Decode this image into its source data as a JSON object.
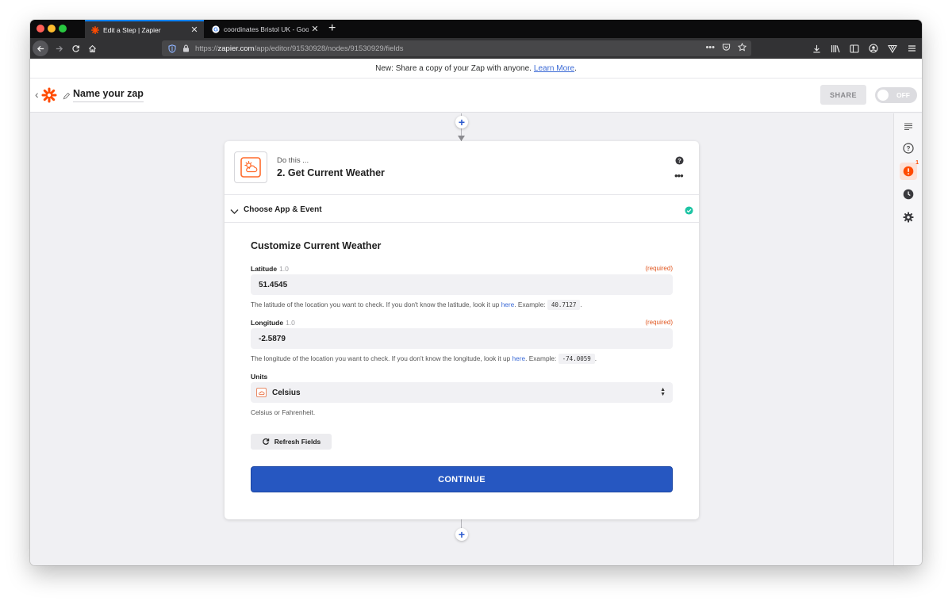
{
  "browser": {
    "tabs": [
      {
        "label": "Edit a Step | Zapier",
        "icon": "zapier-favicon",
        "active": true
      },
      {
        "label": "coordinates Bristol UK - Google",
        "icon": "google-favicon",
        "active": false
      }
    ],
    "new_tab": "+",
    "url": {
      "prefix": "https://",
      "host": "zapier.com",
      "path": "/app/editor/91530928/nodes/91530929/fields"
    },
    "url_actions": [
      "more-icon",
      "pocket-icon",
      "bookmark-star-icon"
    ],
    "toolbar_icons": [
      "download-icon",
      "library-icon",
      "sidebar-icon",
      "account-icon",
      "vpn-icon",
      "menu-icon"
    ]
  },
  "banner": {
    "text": "New: Share a copy of your Zap with anyone.",
    "link": "Learn More",
    "period": "."
  },
  "header": {
    "zap_name": "Name your zap",
    "share": "SHARE",
    "toggle": "OFF"
  },
  "sidebar": {
    "icons": [
      "notes-icon",
      "help-circle-icon",
      "alert-icon",
      "history-icon",
      "settings-icon"
    ],
    "alert_count": "1"
  },
  "step": {
    "prefix": "Do this ...",
    "title": "2. Get Current Weather",
    "accordion_label": "Choose App & Event",
    "section_title": "Customize Current Weather",
    "latitude": {
      "label": "Latitude",
      "version": "1.0",
      "required": "(required)",
      "value": "51.4545",
      "help_before": "The latitude of the location you want to check. If you don't know the latitude, look it up",
      "help_link": "here",
      "help_example": ". Example:",
      "example_value": "40.7127",
      "help_after": "."
    },
    "longitude": {
      "label": "Longitude",
      "version": "1.0",
      "required": "(required)",
      "value": "-2.5879",
      "help_before": "The longitude of the location you want to check. If you don't know the longitude, look it up",
      "help_link": "here",
      "help_example": ". Example:",
      "example_value": "-74.0059",
      "help_after": "."
    },
    "units": {
      "label": "Units",
      "value": "Celsius",
      "help": "Celsius or Fahrenheit."
    },
    "refresh": "Refresh Fields",
    "continue": "CONTINUE"
  },
  "colors": {
    "accent": "#2657c1",
    "brand": "#ff4a00",
    "success": "#1ec4a4",
    "required": "#e0561f",
    "link": "#3b6ad6"
  }
}
